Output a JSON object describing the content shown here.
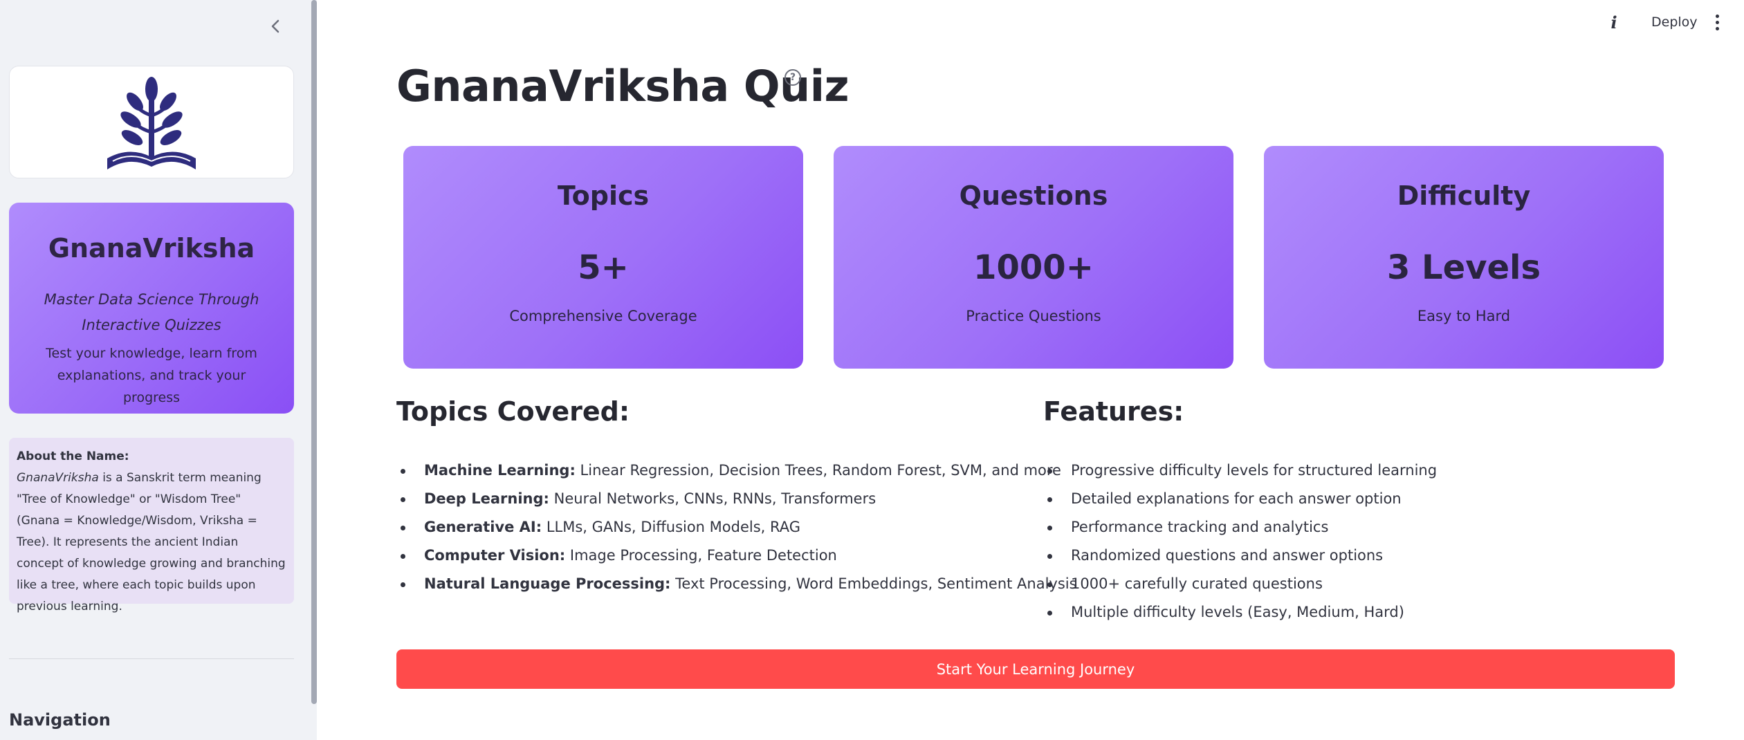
{
  "sidebar": {
    "brand": {
      "title": "GnanaVriksha",
      "tagline": "Master Data Science Through Interactive Quizzes",
      "description": "Test your knowledge, learn from explanations, and track your progress"
    },
    "about": {
      "title": "About the Name:",
      "term": "GnanaVriksha",
      "text": " is a Sanskrit term meaning \"Tree of Knowledge\" or \"Wisdom Tree\" (Gnana = Knowledge/Wisdom, Vriksha = Tree). It represents the ancient Indian concept of knowledge growing and branching like a tree, where each topic builds upon previous learning."
    },
    "nav_heading": "Navigation"
  },
  "toolbar": {
    "info_label": "i",
    "deploy_label": "Deploy"
  },
  "main": {
    "title": "GnanaVriksha Quiz",
    "help_label": "?",
    "stats": [
      {
        "label": "Topics",
        "value": "5+",
        "sub": "Comprehensive Coverage"
      },
      {
        "label": "Questions",
        "value": "1000+",
        "sub": "Practice Questions"
      },
      {
        "label": "Difficulty",
        "value": "3 Levels",
        "sub": "Easy to Hard"
      }
    ],
    "topics": {
      "title": "Topics Covered:",
      "items": [
        {
          "name": "Machine Learning:",
          "detail": " Linear Regression, Decision Trees, Random Forest, SVM, and more"
        },
        {
          "name": "Deep Learning:",
          "detail": " Neural Networks, CNNs, RNNs, Transformers"
        },
        {
          "name": "Generative AI:",
          "detail": " LLMs, GANs, Diffusion Models, RAG"
        },
        {
          "name": "Computer Vision:",
          "detail": " Image Processing, Feature Detection"
        },
        {
          "name": "Natural Language Processing:",
          "detail": " Text Processing, Word Embeddings, Sentiment Analysis"
        }
      ]
    },
    "features": {
      "title": "Features:",
      "items": [
        "Progressive difficulty levels for structured learning",
        "Detailed explanations for each answer option",
        "Performance tracking and analytics",
        "Randomized questions and answer options",
        "1000+ carefully curated questions",
        "Multiple difficulty levels (Easy, Medium, Hard)"
      ]
    },
    "cta_label": "Start Your Learning Journey"
  },
  "colors": {
    "accent": "#ff4b4b",
    "card_gradient_start": "#b08cfc",
    "card_gradient_end": "#8c4ff5",
    "logo": "#2e2c7e",
    "sidebar_bg": "#f0f2f6",
    "about_bg": "#e8e0f5"
  }
}
